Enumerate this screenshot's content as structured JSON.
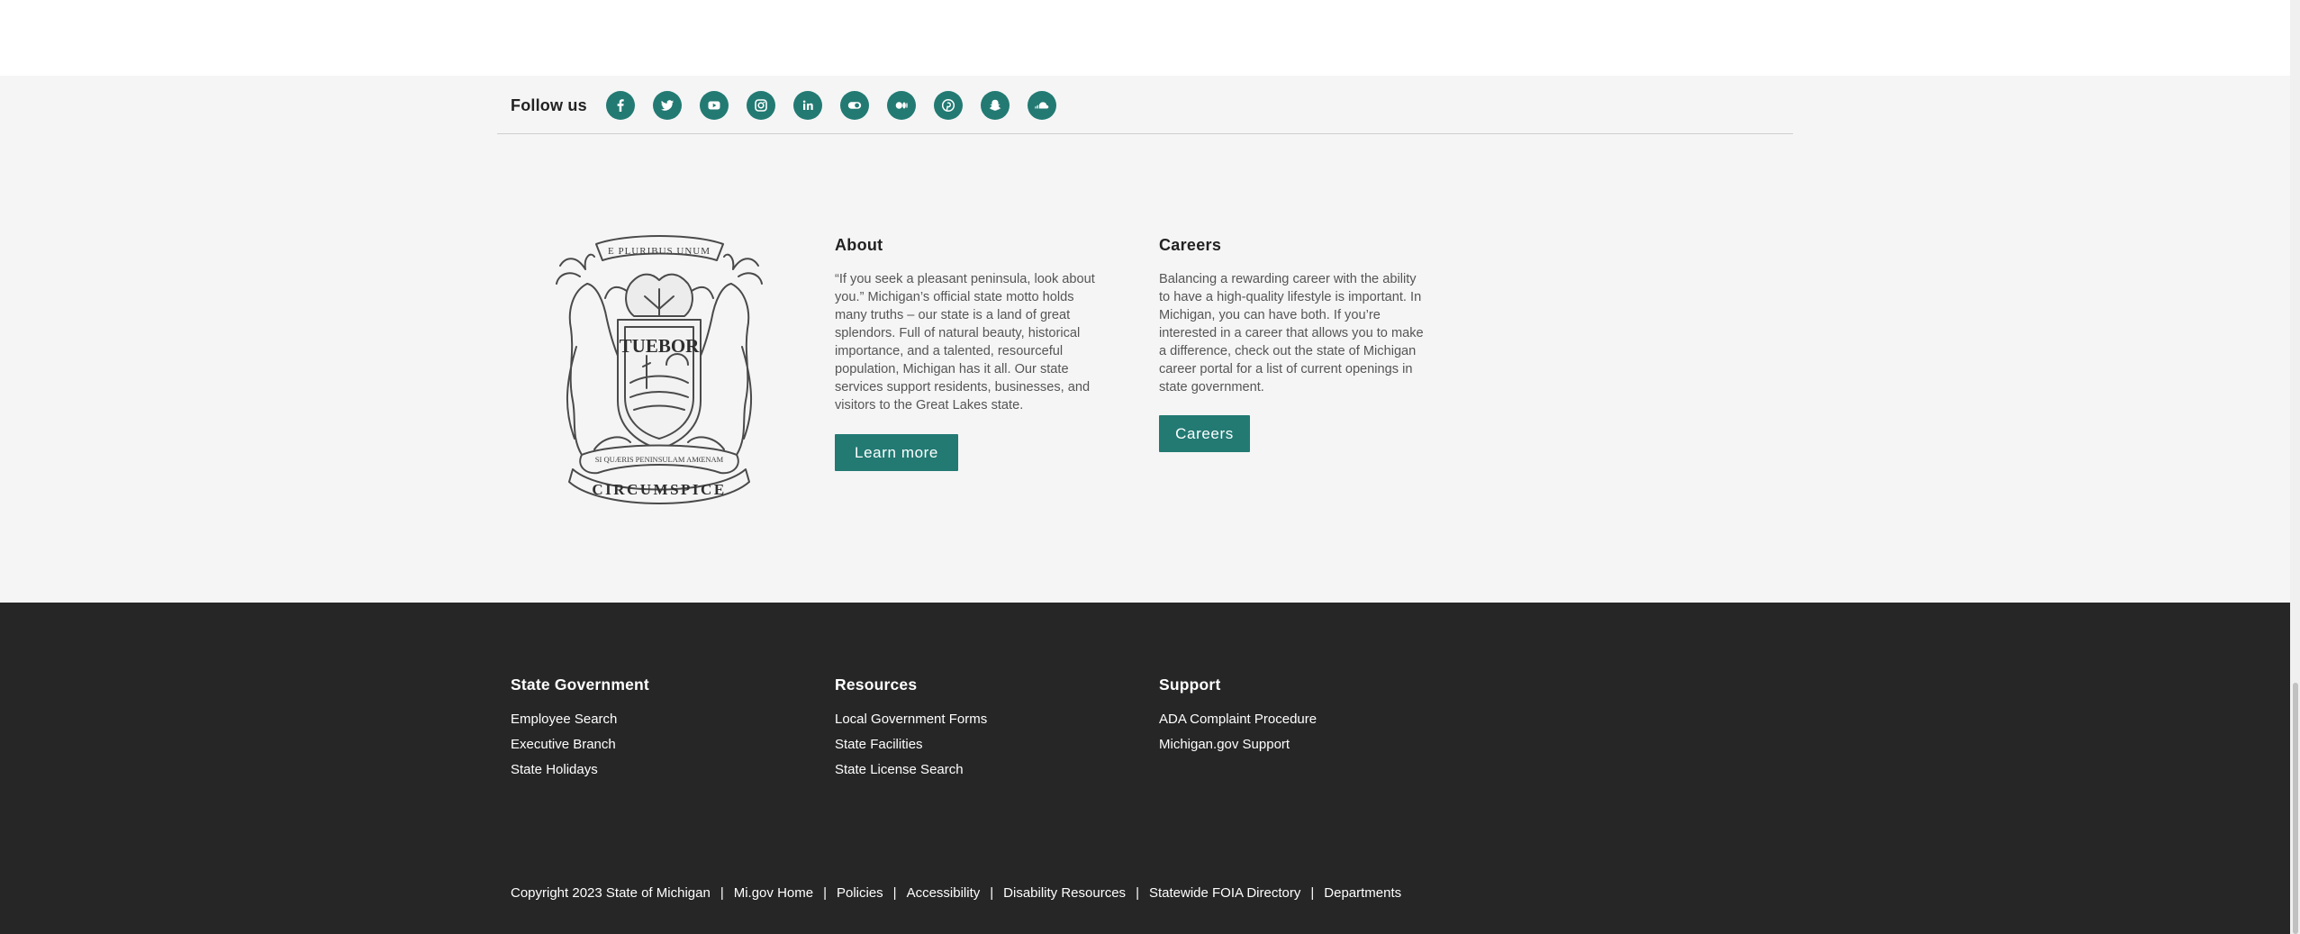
{
  "follow": {
    "label": "Follow us",
    "icons": [
      "facebook-icon",
      "twitter-icon",
      "youtube-icon",
      "instagram-icon",
      "linkedin-icon",
      "flickr-icon",
      "medium-icon",
      "pinterest-icon",
      "snapchat-icon",
      "soundcloud-icon"
    ],
    "icon_bg": "#227a73"
  },
  "seal": {
    "top_motto": "E PLURIBUS UNUM",
    "shield_word": "TUEBOR",
    "ribbon_motto": "SI QUÆRIS PENINSULAM AMŒNAM",
    "bottom_word": "CIRCUMSPICE"
  },
  "about": {
    "heading": "About",
    "lines": [
      "“If you seek a pleasant peninsula, look about",
      "you.” Michigan’s official state motto holds",
      "many truths – our state is a land of great",
      "splendors. Full of natural beauty, historical",
      "importance, and a talented, resourceful",
      "population, Michigan has it all. Our state",
      "services support residents, businesses, and",
      "visitors to the Great Lakes state."
    ],
    "button": "Learn more"
  },
  "careers": {
    "heading": "Careers",
    "lines": [
      "Balancing a rewarding career with the ability",
      "to have a high-quality lifestyle is important. In",
      "Michigan, you can have both. If you’re",
      "interested in a career that allows you to make",
      "a difference, check out the state of Michigan",
      "career portal for a list of current openings in",
      "state government."
    ],
    "button": "Careers"
  },
  "footer": {
    "state_government": {
      "heading": "State Government",
      "links": [
        "Employee Search",
        "Executive Branch",
        "State Holidays"
      ]
    },
    "resources": {
      "heading": "Resources",
      "links": [
        "Local Government Forms",
        "State Facilities",
        "State License Search"
      ]
    },
    "support": {
      "heading": "Support",
      "links": [
        "ADA Complaint Procedure",
        "Michigan.gov Support"
      ]
    }
  },
  "legal": {
    "copyright": "Copyright 2023 State of Michigan",
    "separator": "|",
    "links": [
      "Mi.gov Home",
      "Policies",
      "Accessibility",
      "Disability Resources",
      "Statewide FOIA Directory",
      "Departments"
    ]
  },
  "colors": {
    "accent": "#227a73",
    "dark_bg": "#262626",
    "light_bg": "#f5f5f5"
  }
}
